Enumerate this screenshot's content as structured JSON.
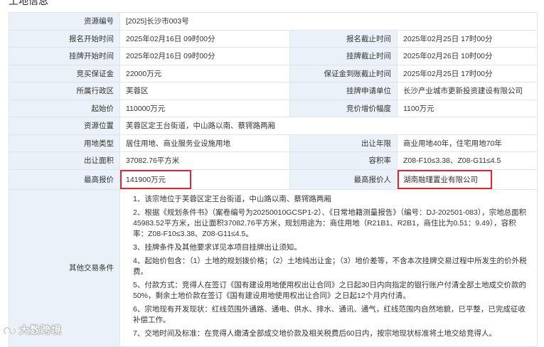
{
  "section_title": "土地信息",
  "rows": {
    "r1": {
      "l1": "资源编号",
      "v1": "[2025]长沙市003号"
    },
    "r2": {
      "l1": "报名开始时间",
      "v1": "2025年02月16日 09时00分",
      "l2": "报名截止时间",
      "v2": "2025年02月25日 17时00分"
    },
    "r3": {
      "l1": "挂牌开始时间",
      "v1": "2025年02月16日 09时00分",
      "l2": "挂牌截止时间",
      "v2": "2025年02月26日 10时00分"
    },
    "r4": {
      "l1": "竞买保证金",
      "v1": "22000万元",
      "l2": "保证金到账截止时间",
      "v2": "2025年02月25日 17时00分"
    },
    "r5": {
      "l1": "所属行政区",
      "v1": "芙蓉区",
      "l2": "挂牌申请单位",
      "v2": "长沙产业城市更新投资建设有限公司"
    },
    "r6": {
      "l1": "起始价",
      "v1": "110000万元",
      "l2": "竞价增价幅度",
      "v2": "1100万元"
    },
    "r7": {
      "l1": "资源位置",
      "v1": "芙蓉区定王台街道，中山路以南、蔡锷路两厢"
    },
    "r8": {
      "l1": "用地类型",
      "v1": "居住用地、商业服务业设施用地",
      "l2": "出让年限",
      "v2": "商业用地40年，住宅用地70年"
    },
    "r9": {
      "l1": "出让面积",
      "v1": "37082.76平方米",
      "l2": "容积率",
      "v2": "Z08-F10≤3.38、Z08-G11≤4.5"
    },
    "r10": {
      "l1": "最高报价",
      "v1": "141900万元",
      "l2": "最高报价人",
      "v2": "湖南融瑾置业有限公司"
    }
  },
  "notes": {
    "label": "其他交易条件",
    "items": [
      "1、该宗地位于芙蓉区定王台街道，中山路以南、蔡锷路两厢",
      "2、根据《规划条件书》（案卷编号为20250010GCSP1-2）、《日常地籍测量报告》（编号：DJ-202501-083），宗地总面积45983.52平方米，出让面积37082.76平方米，规划用途为：商住用地（R21B1、R2B1，商住比为0.51：9.49），容积率：Z08-F10≤3.38、Z08-G11≤4.5。",
      "3、挂牌条件及其他要求详见本项目挂牌出让须知。",
      "4、起始价包含：（1）土地的规划拨价格；（2）土地纯出让金；（3）地价差等，不含本次挂牌交易过程中所发生的价外税费。",
      "5、付款方式：竞得人在签订《国有建设用地使用权出让合同》之日起30日内向指定的银行账户付清全部土地成交价款的50%，剩余土地价款在签订《国有建设用地使用权出让合同》之日起12个月内付清。",
      "6、宗地现有开发现状：红线范围外通路、通电、供水、排水、通讯、通气，红线范围内自然地貌，已平整，已完成征收补偿工作。",
      "7、交地时间及标准：在竞得人缴清全部成交地价款及相关税费后60日内，按宗地现状标准将土地交给竞得人。"
    ]
  },
  "watermark": "大数跨境",
  "colors": {
    "label_bg": "#eaf1f8",
    "border": "#dde6ef",
    "highlight": "#e0282e"
  }
}
